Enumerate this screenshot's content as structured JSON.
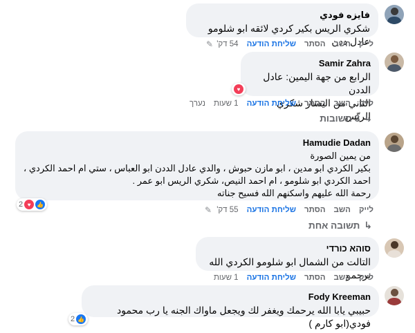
{
  "actions": {
    "like": "לייק",
    "reply": "השב",
    "hide": "הסתר",
    "send": "שליחת הודעה",
    "edited": "נערך"
  },
  "comments": [
    {
      "name": "فايزه فودي",
      "text": "شكري الريس بكير كردي لائقه ابو شلومو عادل ددن",
      "time": "54 דק'"
    },
    {
      "name": "Samir Zahra",
      "text": "الرابع من جهة اليمين: عادل الددن\nالثاني من اليسار شكري الريّس",
      "time": "1 שעות"
    },
    {
      "name": "Hamudie Dadan",
      "text": "من يمين الصورة\nبكير الكردي ابو مدين ، ابو مازن حبوش ، والدي عادل الددن ابو العباس ، ستي ام احمد الكردي ،\nاحمد الكردي ابو شلومو ، ام احمد النيص، شكري الريس ابو عمر .\nرحمة الله عليهم واسكنهم الله فسيح جناته",
      "time": "55 דק'",
      "reactions": "2"
    },
    {
      "name": "סוהא כורדי",
      "text": "التالت من الشمال ابو شلومو الكردي الله يرحمو",
      "time": "1 שעות"
    },
    {
      "name": "Fody Kreeman",
      "text": "حبيبي يابا الله يرحمك ويغفر لك ويجعل ماواك الجنه يا رب محمود فودي(ابو كارم )",
      "reactions": "2"
    }
  ],
  "replies_3": "3 תשובות",
  "replies_1": "תשובה אחת"
}
